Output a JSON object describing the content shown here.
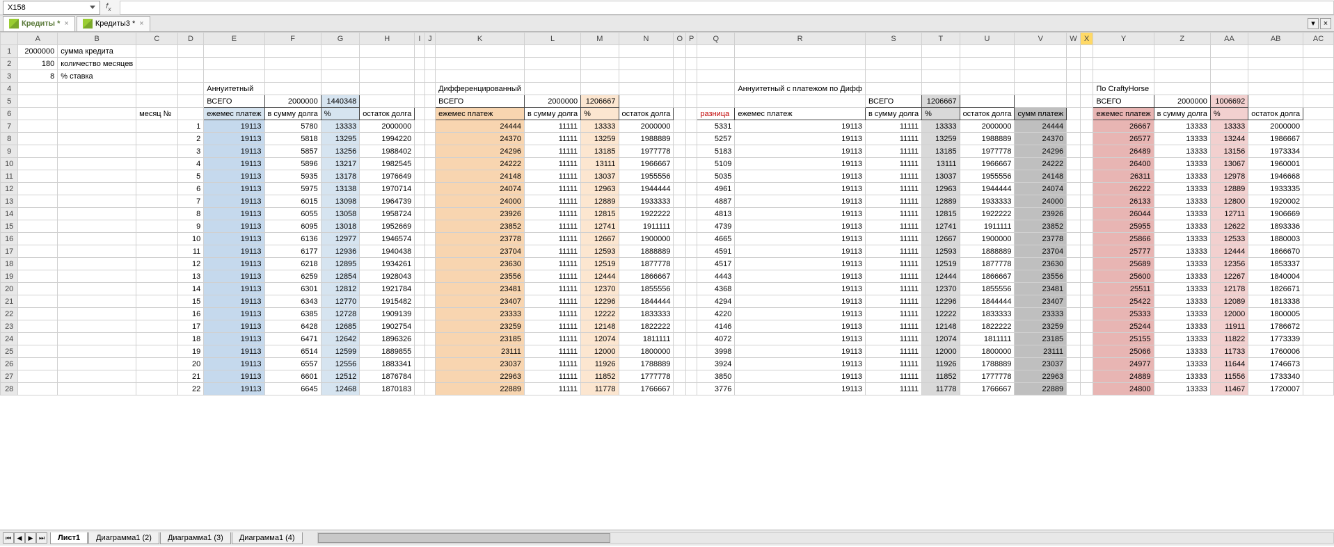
{
  "name_box": "X158",
  "formula": "",
  "workbook_tabs": [
    {
      "name": "Кредиты *",
      "active": true
    },
    {
      "name": "Кредиты3 *",
      "active": false
    }
  ],
  "sheet_tabs": [
    {
      "name": "Лист1",
      "active": true
    },
    {
      "name": "Диаграмма1 (2)",
      "active": false
    },
    {
      "name": "Диаграмма1 (3)",
      "active": false
    },
    {
      "name": "Диаграмма1 (4)",
      "active": false
    }
  ],
  "columns": [
    "A",
    "B",
    "C",
    "D",
    "E",
    "F",
    "G",
    "H",
    "I",
    "J",
    "K",
    "L",
    "M",
    "N",
    "O",
    "P",
    "Q",
    "R",
    "S",
    "T",
    "U",
    "V",
    "W",
    "X",
    "Y",
    "Z",
    "AA",
    "AB",
    "AC"
  ],
  "meta": {
    "r1": {
      "A": "2000000",
      "B": "сумма кредита"
    },
    "r2": {
      "A": "180",
      "B": "количество месяцев"
    },
    "r3": {
      "A": "8",
      "B": "% ставка"
    }
  },
  "section_titles": {
    "ann": "Аннуитетный",
    "diff": "Дифференцированный",
    "annd": "Аннуитетный с платежом по Дифф",
    "ch": "По CraftyHorse"
  },
  "vsego": "ВСЕГО",
  "totals": {
    "ann": {
      "v1": "2000000",
      "v2": "1440348"
    },
    "diff": {
      "v1": "2000000",
      "v2": "1206667"
    },
    "annd": {
      "v1": "1206667",
      "v2": ""
    },
    "ch": {
      "v1": "2000000",
      "v2": "1006692"
    }
  },
  "hdr": {
    "month": "месяц №",
    "pay": "ежемес платеж",
    "prin": "в сумму долга",
    "pct": "%",
    "bal": "остаток долга",
    "razn": "разница",
    "sump": "сумм платеж"
  },
  "rows": [
    {
      "n": 7,
      "m": "1",
      "E": "19113",
      "F": "5780",
      "G": "13333",
      "H": "2000000",
      "K": "24444",
      "L": "11111",
      "M": "13333",
      "N": "2000000",
      "Q": "5331",
      "R": "19113",
      "S": "11111",
      "T": "13333",
      "U": "2000000",
      "V": "24444",
      "Y": "26667",
      "Z": "13333",
      "AA": "13333",
      "AB": "2000000"
    },
    {
      "n": 8,
      "m": "2",
      "E": "19113",
      "F": "5818",
      "G": "13295",
      "H": "1994220",
      "K": "24370",
      "L": "11111",
      "M": "13259",
      "N": "1988889",
      "Q": "5257",
      "R": "19113",
      "S": "11111",
      "T": "13259",
      "U": "1988889",
      "V": "24370",
      "Y": "26577",
      "Z": "13333",
      "AA": "13244",
      "AB": "1986667"
    },
    {
      "n": 9,
      "m": "3",
      "E": "19113",
      "F": "5857",
      "G": "13256",
      "H": "1988402",
      "K": "24296",
      "L": "11111",
      "M": "13185",
      "N": "1977778",
      "Q": "5183",
      "R": "19113",
      "S": "11111",
      "T": "13185",
      "U": "1977778",
      "V": "24296",
      "Y": "26489",
      "Z": "13333",
      "AA": "13156",
      "AB": "1973334"
    },
    {
      "n": 10,
      "m": "4",
      "E": "19113",
      "F": "5896",
      "G": "13217",
      "H": "1982545",
      "K": "24222",
      "L": "11111",
      "M": "13111",
      "N": "1966667",
      "Q": "5109",
      "R": "19113",
      "S": "11111",
      "T": "13111",
      "U": "1966667",
      "V": "24222",
      "Y": "26400",
      "Z": "13333",
      "AA": "13067",
      "AB": "1960001"
    },
    {
      "n": 11,
      "m": "5",
      "E": "19113",
      "F": "5935",
      "G": "13178",
      "H": "1976649",
      "K": "24148",
      "L": "11111",
      "M": "13037",
      "N": "1955556",
      "Q": "5035",
      "R": "19113",
      "S": "11111",
      "T": "13037",
      "U": "1955556",
      "V": "24148",
      "Y": "26311",
      "Z": "13333",
      "AA": "12978",
      "AB": "1946668"
    },
    {
      "n": 12,
      "m": "6",
      "E": "19113",
      "F": "5975",
      "G": "13138",
      "H": "1970714",
      "K": "24074",
      "L": "11111",
      "M": "12963",
      "N": "1944444",
      "Q": "4961",
      "R": "19113",
      "S": "11111",
      "T": "12963",
      "U": "1944444",
      "V": "24074",
      "Y": "26222",
      "Z": "13333",
      "AA": "12889",
      "AB": "1933335"
    },
    {
      "n": 13,
      "m": "7",
      "E": "19113",
      "F": "6015",
      "G": "13098",
      "H": "1964739",
      "K": "24000",
      "L": "11111",
      "M": "12889",
      "N": "1933333",
      "Q": "4887",
      "R": "19113",
      "S": "11111",
      "T": "12889",
      "U": "1933333",
      "V": "24000",
      "Y": "26133",
      "Z": "13333",
      "AA": "12800",
      "AB": "1920002"
    },
    {
      "n": 14,
      "m": "8",
      "E": "19113",
      "F": "6055",
      "G": "13058",
      "H": "1958724",
      "K": "23926",
      "L": "11111",
      "M": "12815",
      "N": "1922222",
      "Q": "4813",
      "R": "19113",
      "S": "11111",
      "T": "12815",
      "U": "1922222",
      "V": "23926",
      "Y": "26044",
      "Z": "13333",
      "AA": "12711",
      "AB": "1906669"
    },
    {
      "n": 15,
      "m": "9",
      "E": "19113",
      "F": "6095",
      "G": "13018",
      "H": "1952669",
      "K": "23852",
      "L": "11111",
      "M": "12741",
      "N": "1911111",
      "Q": "4739",
      "R": "19113",
      "S": "11111",
      "T": "12741",
      "U": "1911111",
      "V": "23852",
      "Y": "25955",
      "Z": "13333",
      "AA": "12622",
      "AB": "1893336"
    },
    {
      "n": 16,
      "m": "10",
      "E": "19113",
      "F": "6136",
      "G": "12977",
      "H": "1946574",
      "K": "23778",
      "L": "11111",
      "M": "12667",
      "N": "1900000",
      "Q": "4665",
      "R": "19113",
      "S": "11111",
      "T": "12667",
      "U": "1900000",
      "V": "23778",
      "Y": "25866",
      "Z": "13333",
      "AA": "12533",
      "AB": "1880003"
    },
    {
      "n": 17,
      "m": "11",
      "E": "19113",
      "F": "6177",
      "G": "12936",
      "H": "1940438",
      "K": "23704",
      "L": "11111",
      "M": "12593",
      "N": "1888889",
      "Q": "4591",
      "R": "19113",
      "S": "11111",
      "T": "12593",
      "U": "1888889",
      "V": "23704",
      "Y": "25777",
      "Z": "13333",
      "AA": "12444",
      "AB": "1866670"
    },
    {
      "n": 18,
      "m": "12",
      "E": "19113",
      "F": "6218",
      "G": "12895",
      "H": "1934261",
      "K": "23630",
      "L": "11111",
      "M": "12519",
      "N": "1877778",
      "Q": "4517",
      "R": "19113",
      "S": "11111",
      "T": "12519",
      "U": "1877778",
      "V": "23630",
      "Y": "25689",
      "Z": "13333",
      "AA": "12356",
      "AB": "1853337"
    },
    {
      "n": 19,
      "m": "13",
      "E": "19113",
      "F": "6259",
      "G": "12854",
      "H": "1928043",
      "K": "23556",
      "L": "11111",
      "M": "12444",
      "N": "1866667",
      "Q": "4443",
      "R": "19113",
      "S": "11111",
      "T": "12444",
      "U": "1866667",
      "V": "23556",
      "Y": "25600",
      "Z": "13333",
      "AA": "12267",
      "AB": "1840004"
    },
    {
      "n": 20,
      "m": "14",
      "E": "19113",
      "F": "6301",
      "G": "12812",
      "H": "1921784",
      "K": "23481",
      "L": "11111",
      "M": "12370",
      "N": "1855556",
      "Q": "4368",
      "R": "19113",
      "S": "11111",
      "T": "12370",
      "U": "1855556",
      "V": "23481",
      "Y": "25511",
      "Z": "13333",
      "AA": "12178",
      "AB": "1826671"
    },
    {
      "n": 21,
      "m": "15",
      "E": "19113",
      "F": "6343",
      "G": "12770",
      "H": "1915482",
      "K": "23407",
      "L": "11111",
      "M": "12296",
      "N": "1844444",
      "Q": "4294",
      "R": "19113",
      "S": "11111",
      "T": "12296",
      "U": "1844444",
      "V": "23407",
      "Y": "25422",
      "Z": "13333",
      "AA": "12089",
      "AB": "1813338"
    },
    {
      "n": 22,
      "m": "16",
      "E": "19113",
      "F": "6385",
      "G": "12728",
      "H": "1909139",
      "K": "23333",
      "L": "11111",
      "M": "12222",
      "N": "1833333",
      "Q": "4220",
      "R": "19113",
      "S": "11111",
      "T": "12222",
      "U": "1833333",
      "V": "23333",
      "Y": "25333",
      "Z": "13333",
      "AA": "12000",
      "AB": "1800005"
    },
    {
      "n": 23,
      "m": "17",
      "E": "19113",
      "F": "6428",
      "G": "12685",
      "H": "1902754",
      "K": "23259",
      "L": "11111",
      "M": "12148",
      "N": "1822222",
      "Q": "4146",
      "R": "19113",
      "S": "11111",
      "T": "12148",
      "U": "1822222",
      "V": "23259",
      "Y": "25244",
      "Z": "13333",
      "AA": "11911",
      "AB": "1786672"
    },
    {
      "n": 24,
      "m": "18",
      "E": "19113",
      "F": "6471",
      "G": "12642",
      "H": "1896326",
      "K": "23185",
      "L": "11111",
      "M": "12074",
      "N": "1811111",
      "Q": "4072",
      "R": "19113",
      "S": "11111",
      "T": "12074",
      "U": "1811111",
      "V": "23185",
      "Y": "25155",
      "Z": "13333",
      "AA": "11822",
      "AB": "1773339"
    },
    {
      "n": 25,
      "m": "19",
      "E": "19113",
      "F": "6514",
      "G": "12599",
      "H": "1889855",
      "K": "23111",
      "L": "11111",
      "M": "12000",
      "N": "1800000",
      "Q": "3998",
      "R": "19113",
      "S": "11111",
      "T": "12000",
      "U": "1800000",
      "V": "23111",
      "Y": "25066",
      "Z": "13333",
      "AA": "11733",
      "AB": "1760006"
    },
    {
      "n": 26,
      "m": "20",
      "E": "19113",
      "F": "6557",
      "G": "12556",
      "H": "1883341",
      "K": "23037",
      "L": "11111",
      "M": "11926",
      "N": "1788889",
      "Q": "3924",
      "R": "19113",
      "S": "11111",
      "T": "11926",
      "U": "1788889",
      "V": "23037",
      "Y": "24977",
      "Z": "13333",
      "AA": "11644",
      "AB": "1746673"
    },
    {
      "n": 27,
      "m": "21",
      "E": "19113",
      "F": "6601",
      "G": "12512",
      "H": "1876784",
      "K": "22963",
      "L": "11111",
      "M": "11852",
      "N": "1777778",
      "Q": "3850",
      "R": "19113",
      "S": "11111",
      "T": "11852",
      "U": "1777778",
      "V": "22963",
      "Y": "24889",
      "Z": "13333",
      "AA": "11556",
      "AB": "1733340"
    },
    {
      "n": 28,
      "m": "22",
      "E": "19113",
      "F": "6645",
      "G": "12468",
      "H": "1870183",
      "K": "22889",
      "L": "11111",
      "M": "11778",
      "N": "1766667",
      "Q": "3776",
      "R": "19113",
      "S": "11111",
      "T": "11778",
      "U": "1766667",
      "V": "22889",
      "Y": "24800",
      "Z": "13333",
      "AA": "11467",
      "AB": "1720007"
    }
  ]
}
